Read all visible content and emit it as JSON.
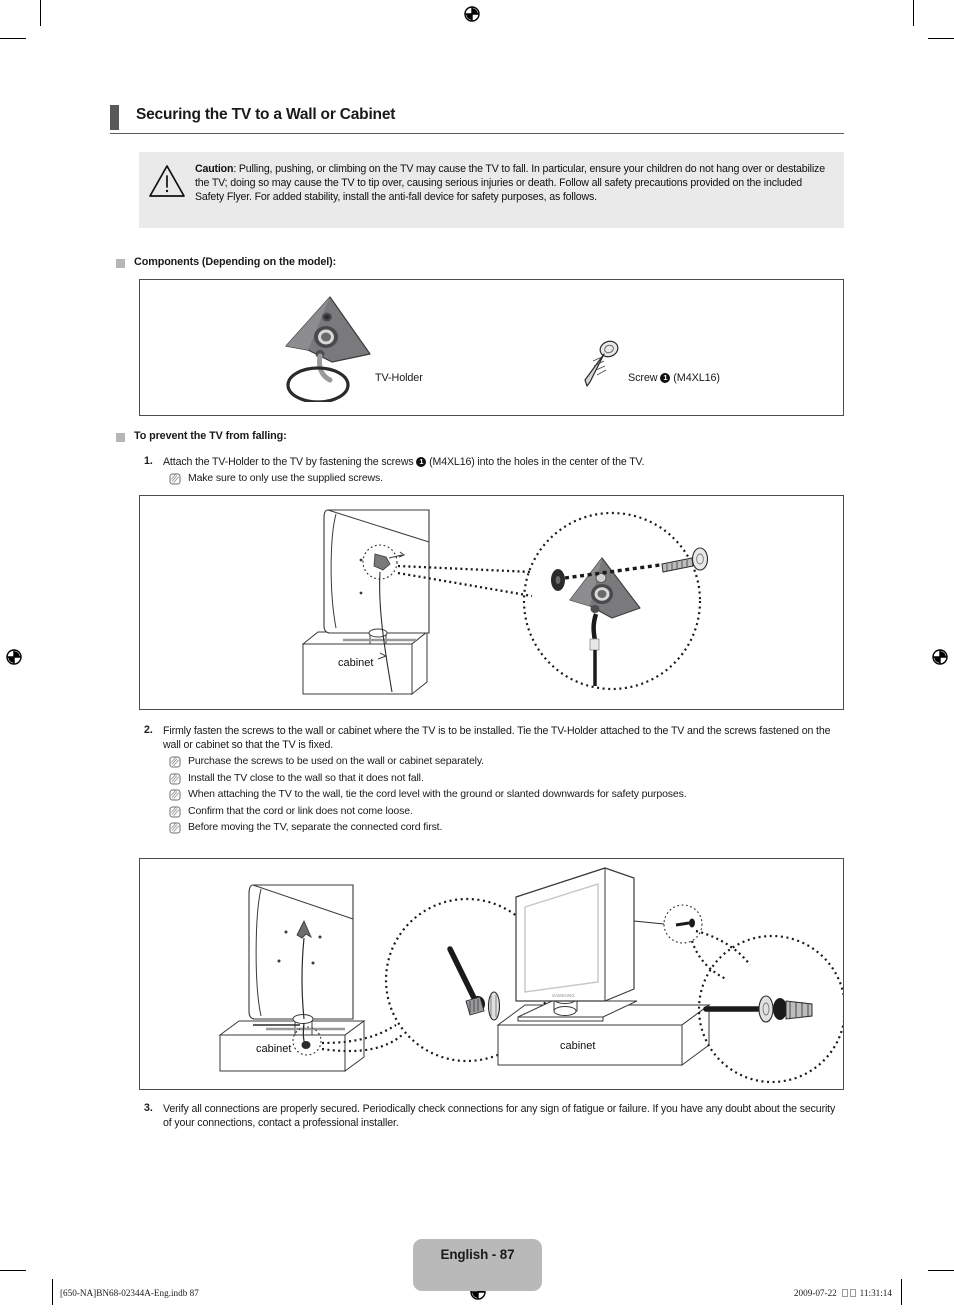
{
  "document": {
    "section_title": "Securing the TV to a Wall or Cabinet",
    "caution": {
      "label": "Caution",
      "text": ": Pulling, pushing, or climbing on the TV may cause the TV to fall. In particular, ensure your children do not hang over or destabilize the TV; doing so may cause the TV to tip over, causing serious injuries or death. Follow all safety precautions provided on the included Safety Flyer. For added stability, install the anti-fall device for safety purposes, as follows.",
      "icon": "warning-triangle-icon"
    },
    "components_section": {
      "heading": "Components (Depending on the model):",
      "items": [
        {
          "label": "TV-Holder",
          "icon": "tv-holder-icon"
        },
        {
          "label_pre": "Screw ",
          "numeral": "1",
          "label_post": " (M4XL16)",
          "icon": "screw-icon"
        }
      ]
    },
    "prevent_section": {
      "heading": "To prevent the TV from falling:",
      "steps": [
        {
          "num": "1.",
          "text_pre": "Attach the TV-Holder to the TV by fastening the screws ",
          "numeral": "1",
          "text_post": " (M4XL16) into the holes in the center of the TV.",
          "notes": [
            "Make sure to only use the supplied screws."
          ]
        },
        {
          "num": "2.",
          "text_pre": "Firmly fasten the screws to the wall or cabinet where the TV is to be installed. Tie the TV-Holder attached to the TV and the screws fastened on the wall or cabinet so that the TV is fixed.",
          "numeral": "",
          "text_post": "",
          "notes": [
            "Purchase the screws to be used on the wall or cabinet separately.",
            "Install the TV close to the wall so that it does not fall.",
            "When attaching the TV to the wall, tie the cord level with the ground or slanted downwards for safety purposes.",
            "Confirm that the cord or link does not come loose.",
            "Before moving the TV, separate the connected cord first."
          ]
        },
        {
          "num": "3.",
          "text_pre": "Verify all connections are properly secured. Periodically check connections for any sign of fatigue or failure. If you have any doubt about the security of your connections, contact a professional installer.",
          "numeral": "",
          "text_post": "",
          "notes": []
        }
      ]
    },
    "figures": {
      "figure1_caption": "cabinet",
      "figure2_caption_left": "cabinet",
      "figure2_caption_right": "cabinet"
    },
    "page_badge": "English - 87",
    "footer": {
      "left": "[650-NA]BN68-02344A-Eng.indb   87",
      "date": "2009-07-22",
      "time": "11:31:14"
    },
    "colors": {
      "header_bar": "#59595b",
      "header_bar_shadow": "#bcbcbe",
      "caution_bg": "#eaeaea",
      "bullet": "#b6b6b8",
      "badge_bg": "#b9b9b9",
      "figure_border": "#4c4c4e",
      "holder_fill": "#6e6e70"
    }
  }
}
